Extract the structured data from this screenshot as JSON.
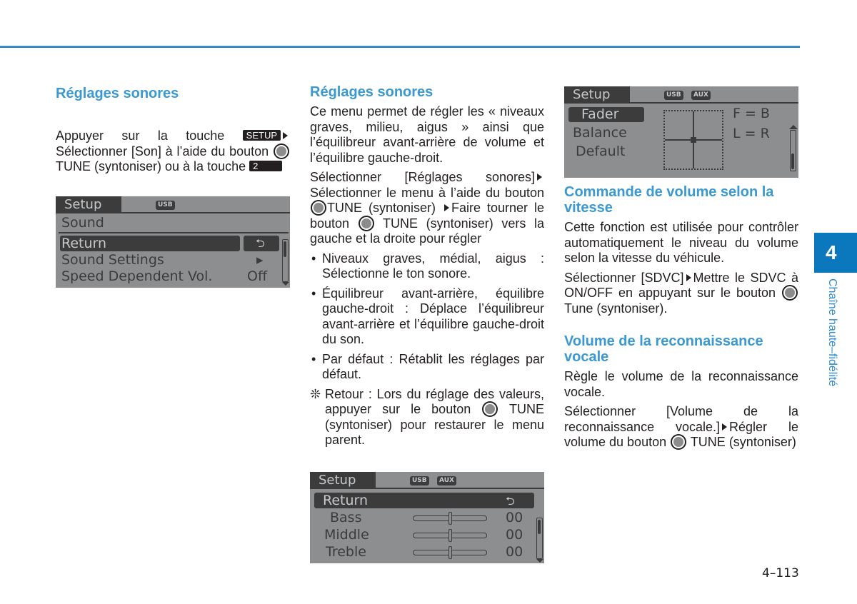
{
  "chapter": {
    "number": "4",
    "title": "Chaîne haute–fidélité"
  },
  "page_number": "4–113",
  "accent_color": "#3a98d3",
  "column1": {
    "heading": "Réglages sonores",
    "intro": {
      "part1": "Appuyer sur la touche",
      "setup_key": "SETUP",
      "part2": "Sélectionner [Son] à l’aide du bouton",
      "part3": "TUNE (syntoniser) ou à la touche",
      "number_key": "2"
    },
    "screen": {
      "tab": "Setup",
      "chips": [
        "USB"
      ],
      "title": "Sound",
      "rows": [
        {
          "label": "Return",
          "value": "⮌",
          "selected": true
        },
        {
          "label": "Sound Settings",
          "value": "▸",
          "selected": false
        },
        {
          "label": "Speed Dependent Vol.",
          "value": "Off",
          "selected": false
        }
      ]
    }
  },
  "column2": {
    "heading": "Réglages sonores",
    "para1": "Ce menu permet de régler les « niveaux graves, milieu, aigus » ainsi que l’équilibreur avant-arrière de volume et l’équilibre gauche-droit.",
    "para2": {
      "part1": "Sélectionner [Réglages sonores]",
      "part2": "Sélectionner le menu à l’aide du bouton",
      "part3": "TUNE (syntoniser)",
      "part4": "Faire tourner le bouton",
      "part5": "TUNE (syntoniser) vers la gauche et la droite pour régler"
    },
    "bullets": [
      {
        "bullet": "•",
        "text": "Niveaux graves, médial, aigus : Sélectionne le ton sonore."
      },
      {
        "bullet": "•",
        "text": "Équilibreur avant-arrière, équilibre gauche-droit : Déplace l’équilibreur avant-arrière et l’équilibre gauche-droit du son."
      },
      {
        "bullet": "•",
        "text": "Par défaut : Rétablit les réglages par défaut."
      }
    ],
    "note": {
      "mark": "❊",
      "part1": "Retour : Lors du réglage des valeurs, appuyer sur le bouton",
      "part2": "TUNE (syntoniser) pour restaurer le menu parent."
    },
    "screen": {
      "tab": "Setup",
      "chips": [
        "USB",
        "AUX"
      ],
      "return_label": "Return",
      "return_icon": "⮌",
      "sliders": [
        {
          "label": "Bass",
          "value": "00",
          "level": 0.5
        },
        {
          "label": "Middle",
          "value": "00",
          "level": 0.5
        },
        {
          "label": "Treble",
          "value": "00",
          "level": 0.5
        }
      ]
    }
  },
  "column3": {
    "screen": {
      "tab": "Setup",
      "chips": [
        "USB",
        "AUX"
      ],
      "menu": [
        {
          "label": "Fader",
          "selected": true
        },
        {
          "label": "Balance",
          "selected": false
        },
        {
          "label": "Default",
          "selected": false
        }
      ],
      "fader_readout": "F = B",
      "balance_readout": "L = R"
    },
    "section1": {
      "heading": "Commande de volume selon la vitesse",
      "para1": "Cette fonction est utilisée pour contrôler automatiquement le niveau du volume selon la vitesse du véhicule.",
      "para2": {
        "part1": "Sélectionner [SDVC]",
        "part2": "Mettre le SDVC à ON/OFF en appuyant sur le bouton",
        "part3": "Tune (syntoniser)."
      }
    },
    "section2": {
      "heading": "Volume de la reconnaissance vocale",
      "para1": "Règle le volume de la reconnaissance vocale.",
      "para2": {
        "part1": "Sélectionner [Volume de la reconnaissance vocale.]",
        "part2": "Régler le volume du bouton",
        "part3": "TUNE (syntoniser)"
      }
    }
  }
}
